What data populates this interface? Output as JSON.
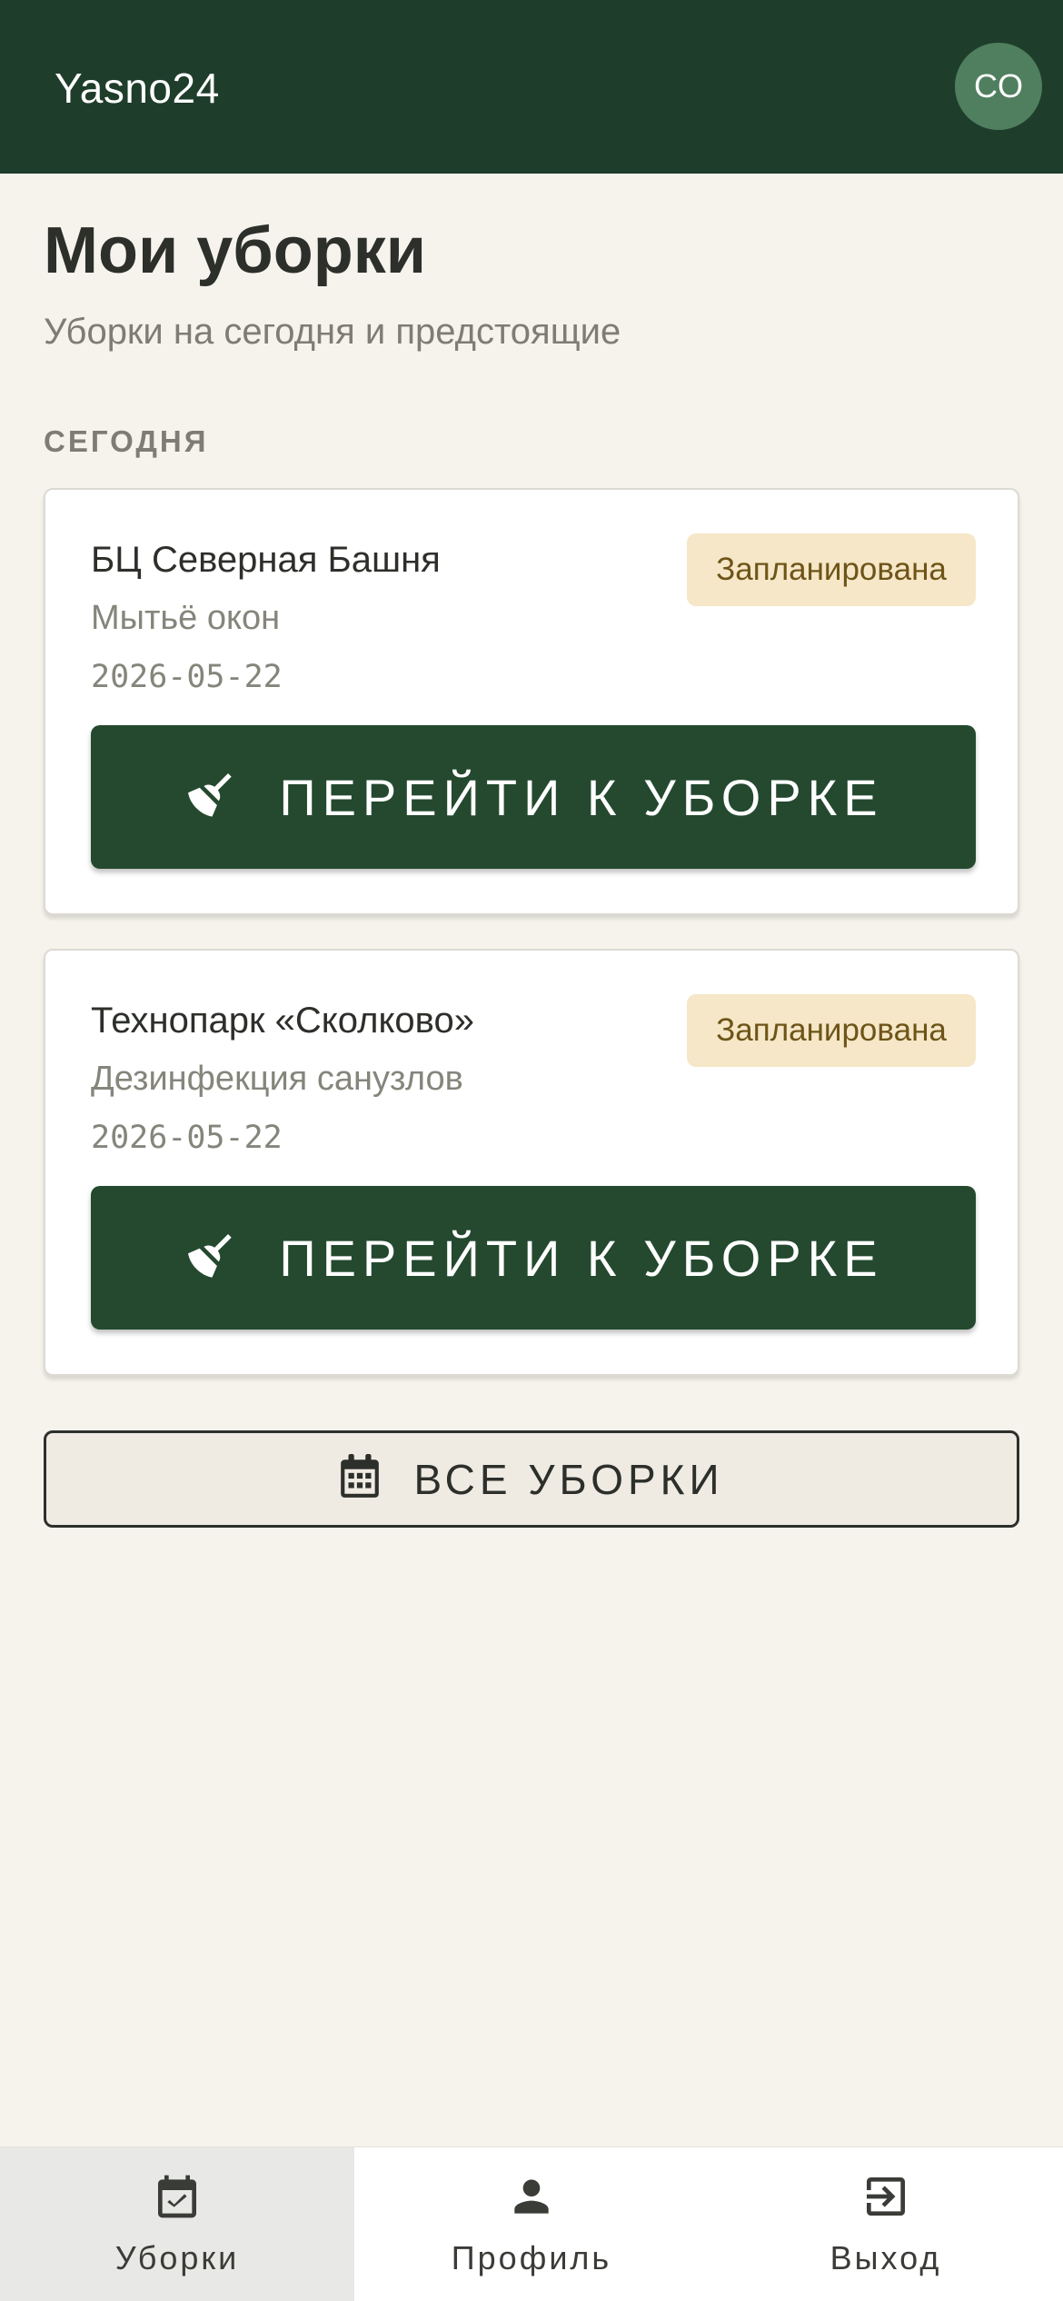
{
  "app": {
    "title": "Yasno24",
    "avatar_initials": "CO"
  },
  "page": {
    "title": "Мои уборки",
    "subtitle": "Уборки на сегодня и предстоящие",
    "section_label": "СЕГОДНЯ"
  },
  "cleanings": [
    {
      "object": "БЦ Северная Башня",
      "service": "Мытьё окон",
      "date": "2026-05-22",
      "status": "Запланирована",
      "button_label": "ПЕРЕЙТИ К УБОРКЕ",
      "button_icon": "broom-icon"
    },
    {
      "object": "Технопарк «Сколково»",
      "service": "Дезинфекция санузлов",
      "date": "2026-05-22",
      "status": "Запланирована",
      "button_label": "ПЕРЕЙТИ К УБОРКЕ",
      "button_icon": "broom-icon"
    }
  ],
  "all_button": {
    "label": "ВСЕ УБОРКИ",
    "icon": "calendar-icon"
  },
  "bottom_nav": [
    {
      "label": "Уборки",
      "icon": "calendar-check-icon",
      "active": true
    },
    {
      "label": "Профиль",
      "icon": "person-icon",
      "active": false
    },
    {
      "label": "Выход",
      "icon": "logout-icon",
      "active": false
    }
  ],
  "colors": {
    "appbar": "#1f3d2b",
    "primary_button": "#24492f",
    "background": "#f6f3ec",
    "badge_bg": "#f5e7c7",
    "badge_text": "#6e5419"
  }
}
